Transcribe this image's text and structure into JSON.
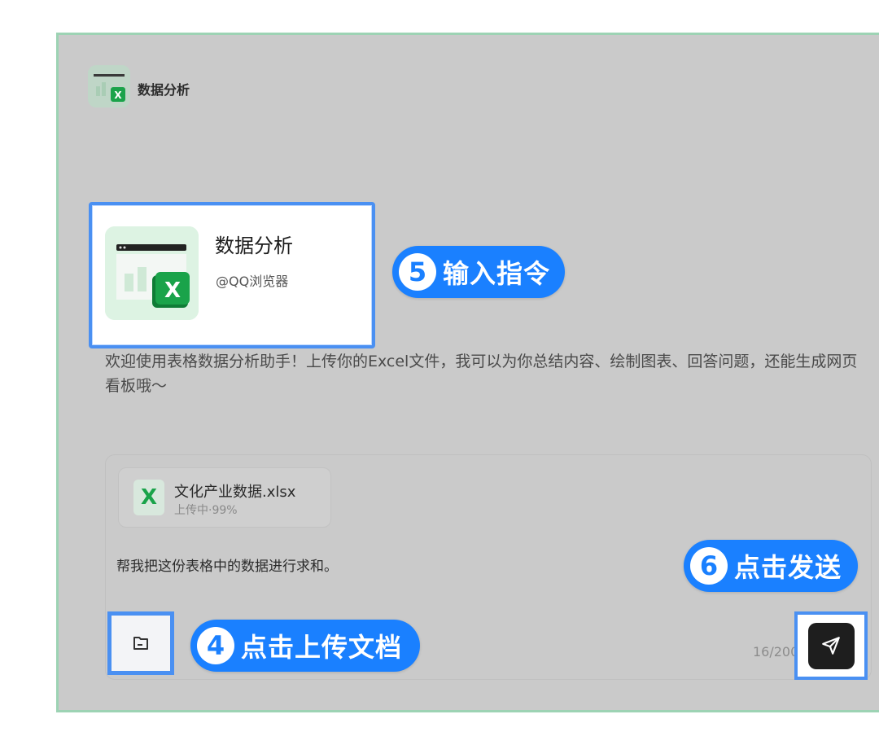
{
  "header": {
    "app_name": "数据分析"
  },
  "card": {
    "title": "数据分析",
    "publisher": "@QQ浏览器"
  },
  "badges": [
    {
      "num": "5",
      "text": "输入指令"
    },
    {
      "num": "6",
      "text": "点击发送"
    },
    {
      "num": "4",
      "text": "点击上传文档"
    }
  ],
  "welcome": "欢迎使用表格数据分析助手！上传你的Excel文件，我可以为你总结内容、绘制图表、回答问题，还能生成网页看板哦～",
  "file": {
    "icon_letter": "X",
    "name": "文化产业数据.xlsx",
    "status": "上传中·99%"
  },
  "prompt": "帮我把这份表格中的数据进行求和。",
  "counter": "16/200",
  "icons": {
    "upload": "folder-icon",
    "send": "paper-plane-icon",
    "app": "excel-icon"
  },
  "colors": {
    "accent": "#1a80ff",
    "excel_green": "#1aa34a",
    "frame_border": "#9dd3b4"
  }
}
